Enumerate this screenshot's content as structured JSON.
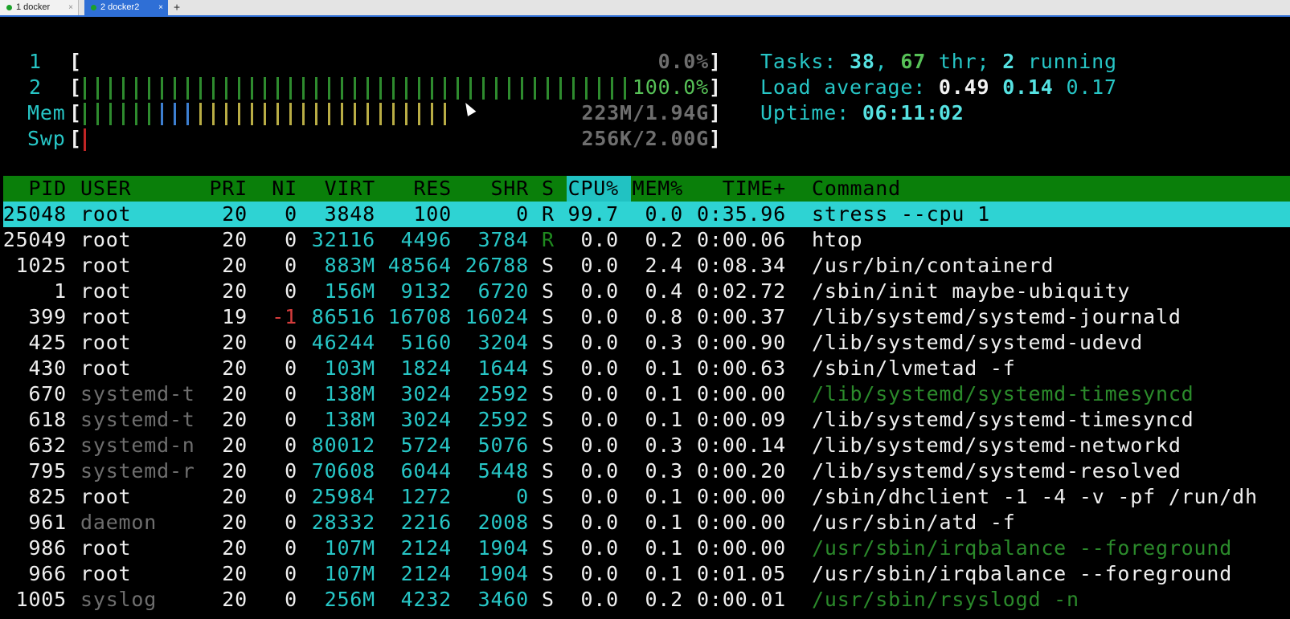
{
  "tabs": [
    {
      "label": "1 docker",
      "active": false
    },
    {
      "label": "2 docker2",
      "active": true
    }
  ],
  "tab_new_label": "+",
  "tab_close_glyph": "×",
  "meters": {
    "cpu1": {
      "label": "1",
      "value": "0.0%",
      "fraction": 0.0
    },
    "cpu2": {
      "label": "2",
      "value": "100.0%",
      "fraction": 1.0
    },
    "mem": {
      "label": "Mem",
      "value": "223M/1.94G"
    },
    "swp": {
      "label": "Swp",
      "value": "256K/2.00G"
    }
  },
  "summary": {
    "tasks_label": "Tasks: ",
    "tasks": "38",
    "sep1": ", ",
    "threads": "67",
    "thr_label": " thr; ",
    "running": "2",
    "running_label": " running",
    "load_label": "Load average: ",
    "load1": "0.49",
    "load5": "0.14",
    "load15": "0.17",
    "uptime_label": "Uptime: ",
    "uptime": "06:11:02"
  },
  "header": {
    "pid": "PID",
    "user": "USER",
    "pri": "PRI",
    "ni": "NI",
    "virt": "VIRT",
    "res": "RES",
    "shr": "SHR",
    "s": "S",
    "cpu": "CPU%",
    "mem": "MEM%",
    "time": "TIME+",
    "command": "Command"
  },
  "processes": [
    {
      "pid": "25048",
      "user": "root",
      "pri": "20",
      "ni": "0",
      "virt": "3848",
      "res": "100",
      "shr": "0",
      "s": "R",
      "cpu": "99.7",
      "mem": "0.0",
      "time": "0:35.96",
      "cmd": "stress --cpu 1"
    },
    {
      "pid": "25049",
      "user": "root",
      "pri": "20",
      "ni": "0",
      "virt": "32116",
      "res": "4496",
      "shr": "3784",
      "s": "R",
      "cpu": "0.0",
      "mem": "0.2",
      "time": "0:00.06",
      "cmd": "htop"
    },
    {
      "pid": "1025",
      "user": "root",
      "pri": "20",
      "ni": "0",
      "virt": "883M",
      "res": "48564",
      "shr": "26788",
      "s": "S",
      "cpu": "0.0",
      "mem": "2.4",
      "time": "0:08.34",
      "cmd": "/usr/bin/containerd"
    },
    {
      "pid": "1",
      "user": "root",
      "pri": "20",
      "ni": "0",
      "virt": "156M",
      "res": "9132",
      "shr": "6720",
      "s": "S",
      "cpu": "0.0",
      "mem": "0.4",
      "time": "0:02.72",
      "cmd": "/sbin/init maybe-ubiquity"
    },
    {
      "pid": "399",
      "user": "root",
      "pri": "19",
      "ni": "-1",
      "virt": "86516",
      "res": "16708",
      "shr": "16024",
      "s": "S",
      "cpu": "0.0",
      "mem": "0.8",
      "time": "0:00.37",
      "cmd": "/lib/systemd/systemd-journald"
    },
    {
      "pid": "425",
      "user": "root",
      "pri": "20",
      "ni": "0",
      "virt": "46244",
      "res": "5160",
      "shr": "3204",
      "s": "S",
      "cpu": "0.0",
      "mem": "0.3",
      "time": "0:00.90",
      "cmd": "/lib/systemd/systemd-udevd"
    },
    {
      "pid": "430",
      "user": "root",
      "pri": "20",
      "ni": "0",
      "virt": "103M",
      "res": "1824",
      "shr": "1644",
      "s": "S",
      "cpu": "0.0",
      "mem": "0.1",
      "time": "0:00.63",
      "cmd": "/sbin/lvmetad -f"
    },
    {
      "pid": "670",
      "user": "systemd-t",
      "pri": "20",
      "ni": "0",
      "virt": "138M",
      "res": "3024",
      "shr": "2592",
      "s": "S",
      "cpu": "0.0",
      "mem": "0.1",
      "time": "0:00.00",
      "cmd": "/lib/systemd/systemd-timesyncd"
    },
    {
      "pid": "618",
      "user": "systemd-t",
      "pri": "20",
      "ni": "0",
      "virt": "138M",
      "res": "3024",
      "shr": "2592",
      "s": "S",
      "cpu": "0.0",
      "mem": "0.1",
      "time": "0:00.09",
      "cmd": "/lib/systemd/systemd-timesyncd"
    },
    {
      "pid": "632",
      "user": "systemd-n",
      "pri": "20",
      "ni": "0",
      "virt": "80012",
      "res": "5724",
      "shr": "5076",
      "s": "S",
      "cpu": "0.0",
      "mem": "0.3",
      "time": "0:00.14",
      "cmd": "/lib/systemd/systemd-networkd"
    },
    {
      "pid": "795",
      "user": "systemd-r",
      "pri": "20",
      "ni": "0",
      "virt": "70608",
      "res": "6044",
      "shr": "5448",
      "s": "S",
      "cpu": "0.0",
      "mem": "0.3",
      "time": "0:00.20",
      "cmd": "/lib/systemd/systemd-resolved"
    },
    {
      "pid": "825",
      "user": "root",
      "pri": "20",
      "ni": "0",
      "virt": "25984",
      "res": "1272",
      "shr": "0",
      "s": "S",
      "cpu": "0.0",
      "mem": "0.1",
      "time": "0:00.00",
      "cmd": "/sbin/dhclient -1 -4 -v -pf /run/dh"
    },
    {
      "pid": "961",
      "user": "daemon",
      "pri": "20",
      "ni": "0",
      "virt": "28332",
      "res": "2216",
      "shr": "2008",
      "s": "S",
      "cpu": "0.0",
      "mem": "0.1",
      "time": "0:00.00",
      "cmd": "/usr/sbin/atd -f"
    },
    {
      "pid": "986",
      "user": "root",
      "pri": "20",
      "ni": "0",
      "virt": "107M",
      "res": "2124",
      "shr": "1904",
      "s": "S",
      "cpu": "0.0",
      "mem": "0.1",
      "time": "0:00.00",
      "cmd": "/usr/sbin/irqbalance --foreground"
    },
    {
      "pid": "966",
      "user": "root",
      "pri": "20",
      "ni": "0",
      "virt": "107M",
      "res": "2124",
      "shr": "1904",
      "s": "S",
      "cpu": "0.0",
      "mem": "0.1",
      "time": "0:01.05",
      "cmd": "/usr/sbin/irqbalance --foreground"
    },
    {
      "pid": "1005",
      "user": "syslog",
      "pri": "20",
      "ni": "0",
      "virt": "256M",
      "res": "4232",
      "shr": "3460",
      "s": "S",
      "cpu": "0.0",
      "mem": "0.2",
      "time": "0:00.01",
      "cmd": "/usr/sbin/rsyslogd -n"
    }
  ],
  "colors": {
    "header_bg": "#0a7f0a",
    "sort_col_bg": "#21c2c2",
    "selected_bg": "#2ed3d3",
    "cyan": "#27c6c6",
    "green": "#57c257",
    "dim": "#8c8c8c",
    "tab_active": "#2f6fd6"
  }
}
